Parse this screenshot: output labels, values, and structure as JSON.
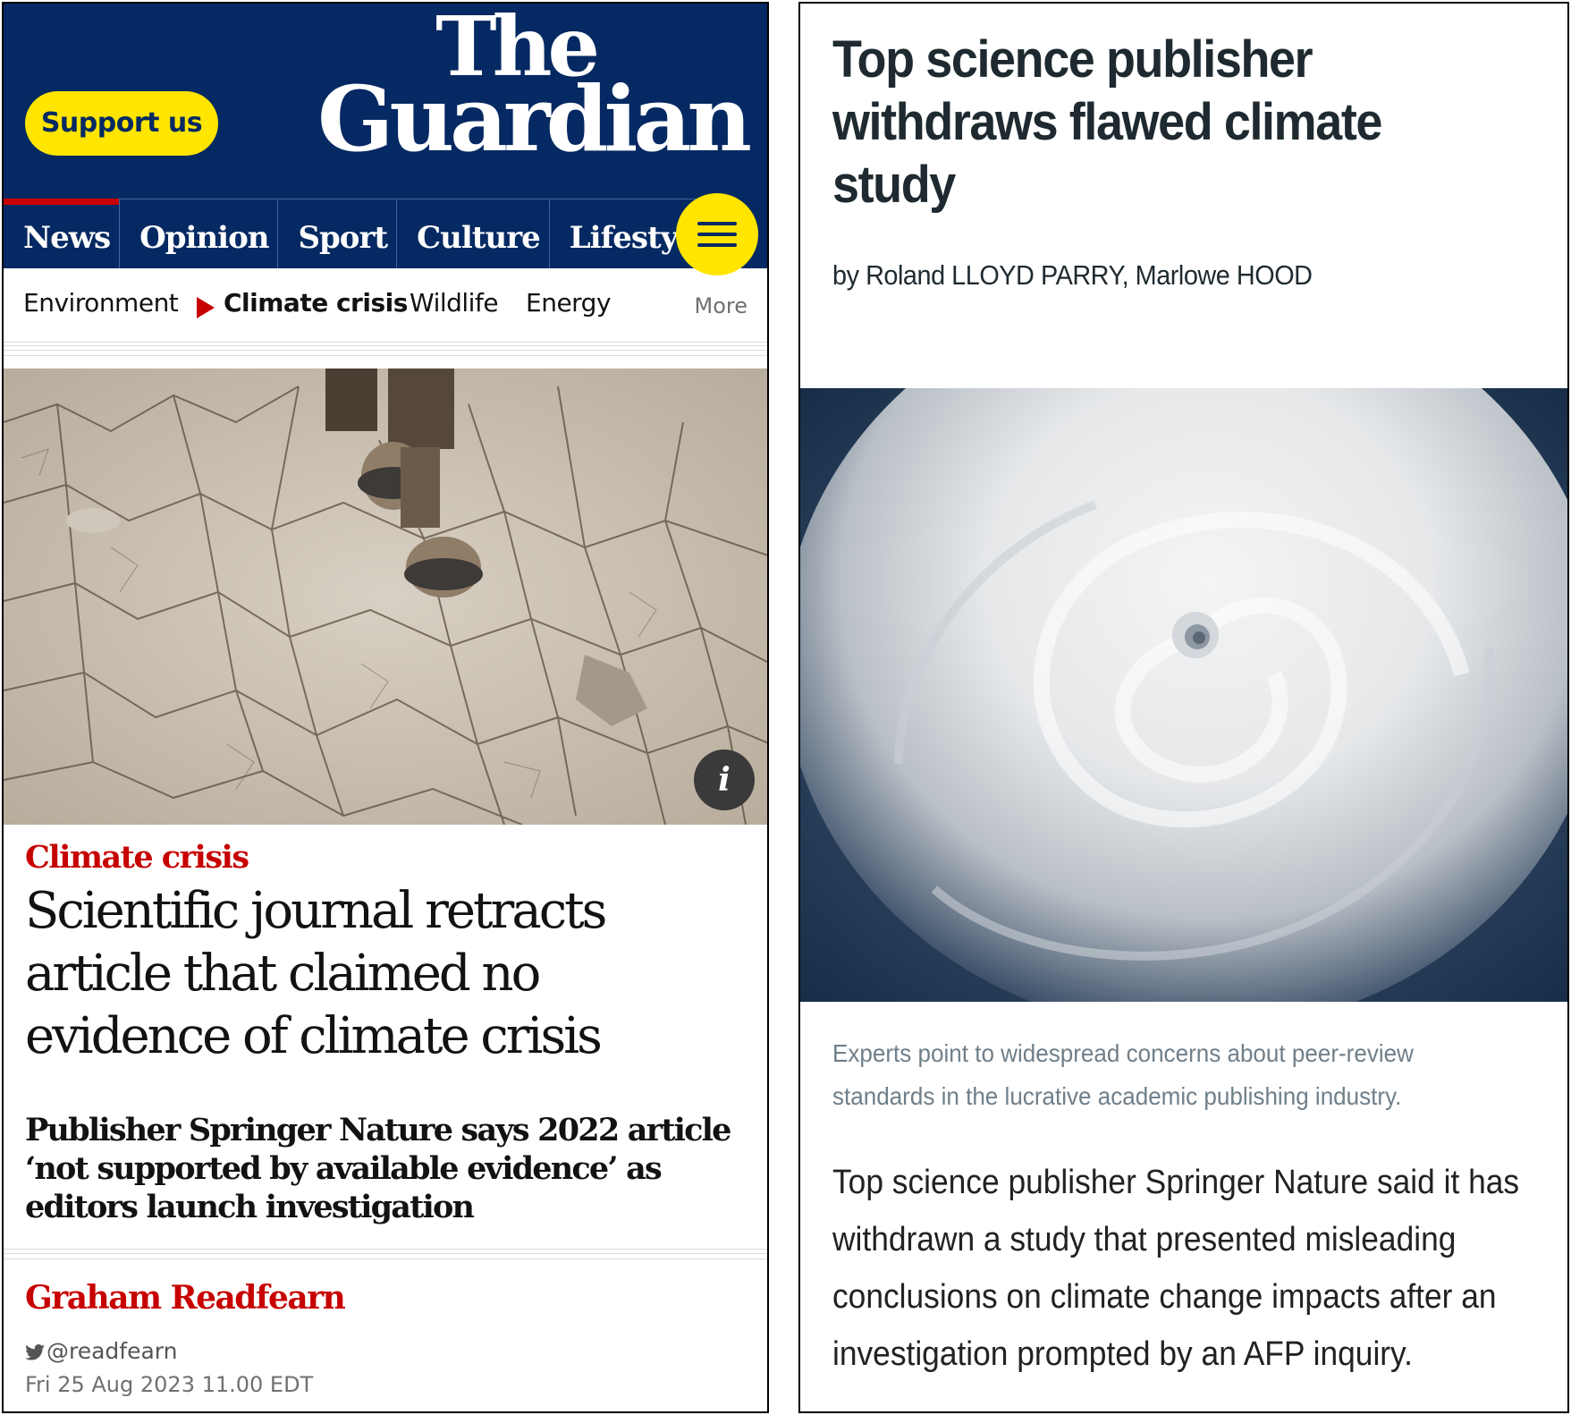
{
  "guardian": {
    "support_label": "Support us",
    "logo_line1": "The",
    "logo_line2": "Guardian",
    "nav": [
      "News",
      "Opinion",
      "Sport",
      "Culture",
      "Lifestyle"
    ],
    "menu_icon": "hamburger-icon",
    "subnav": [
      "Environment",
      "Climate crisis",
      "Wildlife",
      "Energy"
    ],
    "subnav_more": "More",
    "info_icon_label": "i",
    "kicker": "Climate crisis",
    "headline": "Scientific journal retracts article that claimed no evidence of climate crisis",
    "standfirst": "Publisher Springer Nature says 2022 article ‘not supported by available evidence’ as editors launch investigation",
    "author": "Graham Readfearn",
    "twitter_handle": "@readfearn",
    "date": "Fri 25 Aug 2023 11.00 EDT",
    "colors": {
      "brand_blue": "#052962",
      "support_yellow": "#ffe500",
      "accent_red": "#c70000"
    }
  },
  "afp": {
    "headline": "Top science publisher withdraws flawed climate study",
    "byline": "by Roland LLOYD PARRY, Marlowe HOOD",
    "caption": "Experts point to widespread concerns about peer-review standards in the lucrative academic publishing industry.",
    "body": "Top science publisher Springer Nature said it has withdrawn a study that presented misleading conclusions on climate change impacts after an investigation prompted by an AFP inquiry."
  }
}
